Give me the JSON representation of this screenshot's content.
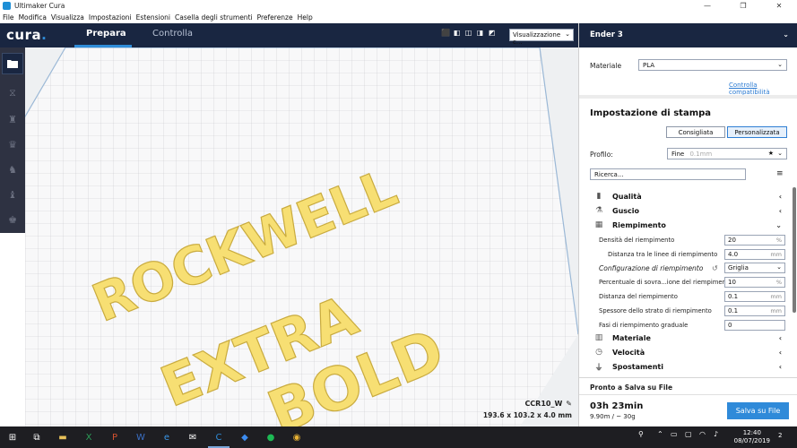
{
  "window": {
    "title": "Ultimaker Cura",
    "minimize": "—",
    "maximize": "❐",
    "close": "✕"
  },
  "menu": [
    "File",
    "Modifica",
    "Visualizza",
    "Impostazioni",
    "Estensioni",
    "Casella degli strumenti",
    "Preferenze",
    "Help"
  ],
  "header": {
    "logo": "cura",
    "tabs": [
      "Prepara",
      "Controlla"
    ],
    "active_tab": "Prepara",
    "view_mode": "Visualizzazione c..."
  },
  "viewport": {
    "model_name": "CCR10_W",
    "model_dims": "193.6 x 103.2 x 4.0 mm",
    "model_text": [
      "ROCKWELL",
      "EXTRA",
      "BOLD"
    ],
    "model_color": "#f7df73"
  },
  "sidebar": {
    "printer": "Ender 3",
    "material_label": "Materiale",
    "material_value": "PLA",
    "compat_link": "Controlla compatibilità",
    "print_setup_title": "Impostazione di stampa",
    "mode_recommended": "Consigliata",
    "mode_custom": "Personalizzata",
    "profile_label": "Profilo:",
    "profile_value": "Fine",
    "profile_hint": "0.1mm",
    "search_placeholder": "Ricerca...",
    "categories": {
      "quality": "Qualità",
      "shell": "Guscio",
      "infill": "Riempimento",
      "material": "Materiale",
      "speed": "Velocità",
      "travel": "Spostamenti"
    },
    "settings": [
      {
        "label": "Densità del riempimento",
        "value": "20",
        "unit": "%"
      },
      {
        "label": "Distanza tra le linee di riempimento",
        "value": "4.0",
        "unit": "mm"
      },
      {
        "label": "Configurazione di riempimento",
        "value": "Griglia",
        "unit": ""
      },
      {
        "label": "Percentuale di sovra...ione del riempimento",
        "value": "10",
        "unit": "%"
      },
      {
        "label": "Distanza del riempimento",
        "value": "0.1",
        "unit": "mm"
      },
      {
        "label": "Spessore dello strato di riempimento",
        "value": "0.1",
        "unit": "mm"
      },
      {
        "label": "Fasi di riempimento graduale",
        "value": "0",
        "unit": ""
      }
    ],
    "save": {
      "status": "Pronto a Salva su File",
      "time": "03h 23min",
      "material_usage": "9.90m / ~ 30g",
      "button": "Salva su File"
    }
  },
  "taskbar": {
    "time": "12:40",
    "date": "08/07/2019",
    "notifications": "2"
  }
}
